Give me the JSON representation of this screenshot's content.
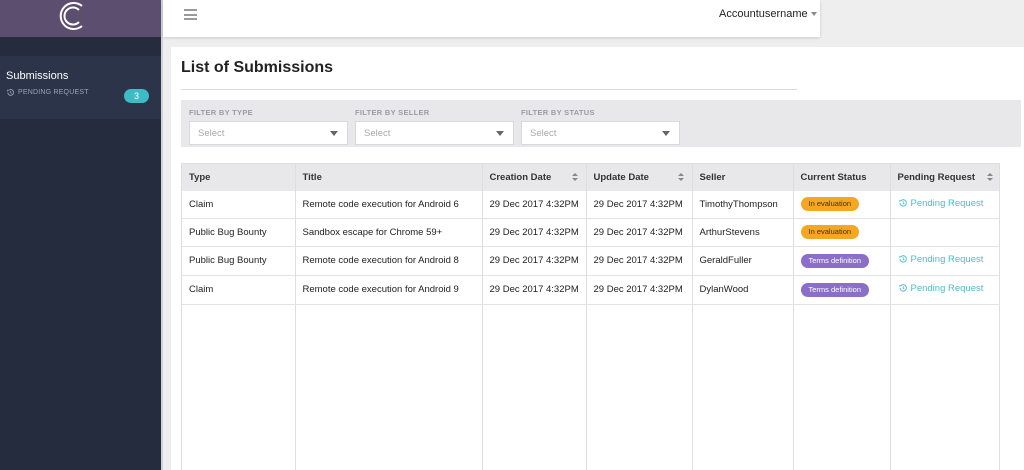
{
  "sidebar": {
    "logo": "c-logo",
    "nav_title": "Submissions",
    "nav_sub_label": "PENDING REQUEST",
    "pending_count": "3"
  },
  "topbar": {
    "account_name": "Accountusername"
  },
  "page": {
    "title": "List of Submissions"
  },
  "filters": [
    {
      "label": "FILTER BY TYPE",
      "value": "Select"
    },
    {
      "label": "FILTER BY SELLER",
      "value": "Select"
    },
    {
      "label": "FILTER BY STATUS",
      "value": "Select"
    }
  ],
  "table": {
    "columns": [
      "Type",
      "Title",
      "Creation Date",
      "Update Date",
      "Seller",
      "Current Status",
      "Pending Request"
    ],
    "rows": [
      {
        "type": "Claim",
        "title": "Remote code execution for Android 6",
        "created": "29 Dec 2017 4:32PM",
        "updated": "29 Dec 2017 4:32PM",
        "seller": "TimothyThompson",
        "status": "In evaluation",
        "pending": "Pending Request"
      },
      {
        "type": "Public Bug Bounty",
        "title": "Sandbox escape for Chrome 59+",
        "created": "29 Dec 2017 4:32PM",
        "updated": "29 Dec 2017 4:32PM",
        "seller": "ArthurStevens",
        "status": "In evaluation",
        "pending": ""
      },
      {
        "type": "Public Bug Bounty",
        "title": "Remote code execution for Android 8",
        "created": "29 Dec 2017 4:32PM",
        "updated": "29 Dec 2017 4:32PM",
        "seller": "GeraldFuller",
        "status": "Terms definition",
        "pending": "Pending Request"
      },
      {
        "type": "Claim",
        "title": "Remote code execution for Android 9",
        "created": "29 Dec 2017 4:32PM",
        "updated": "29 Dec 2017 4:32PM",
        "seller": "DylanWood",
        "status": "Terms definition",
        "pending": "Pending Request"
      }
    ]
  },
  "colors": {
    "sidebar_bg": "#242c3d",
    "logo_bg": "#5c4e6e",
    "accent_teal": "#3ebcc6",
    "status_evaluation": "#f5a623",
    "status_terms": "#8a6ec8",
    "link": "#4fbdc9"
  },
  "icons": {
    "menu": "hamburger-icon",
    "account_caret": "caret-down-icon",
    "select_arrow": "chevron-down-icon",
    "pending": "history-icon",
    "sort": "sort-icon"
  }
}
